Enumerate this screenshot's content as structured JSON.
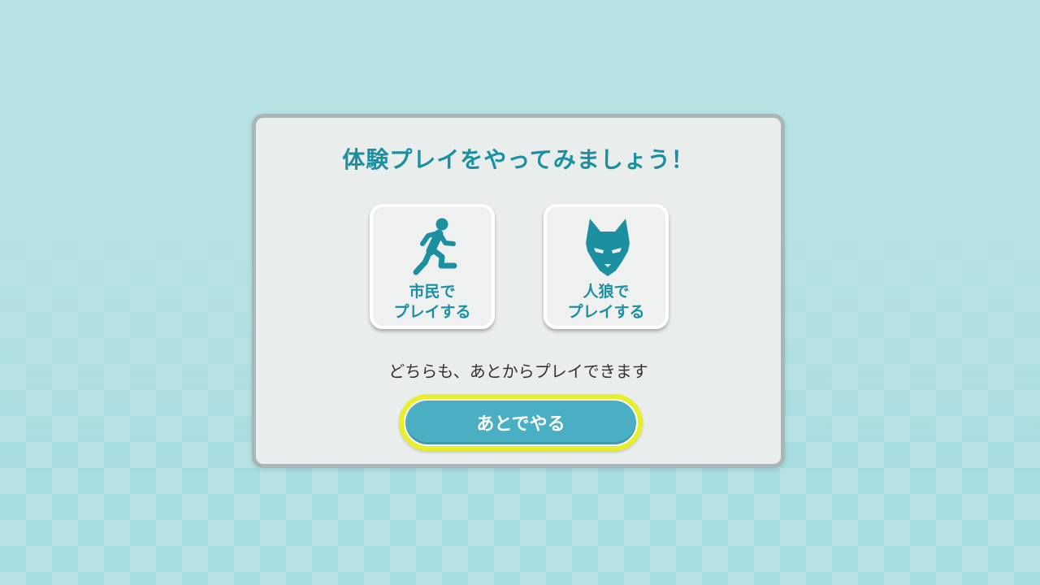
{
  "dialog": {
    "title": "体験プレイをやってみましょう！",
    "choices": [
      {
        "id": "citizen",
        "icon": "running-person-icon",
        "line1": "市民で",
        "line2": "プレイする"
      },
      {
        "id": "werewolf",
        "icon": "wolf-head-icon",
        "line1": "人狼で",
        "line2": "プレイする"
      }
    ],
    "hint": "どちらも、あとからプレイできます",
    "later_button": "あとでやる"
  },
  "colors": {
    "accent": "#1c8fa0",
    "button": "#4aafc2",
    "focus_outline": "#e6ef2a",
    "background": "#b6e2e3"
  }
}
